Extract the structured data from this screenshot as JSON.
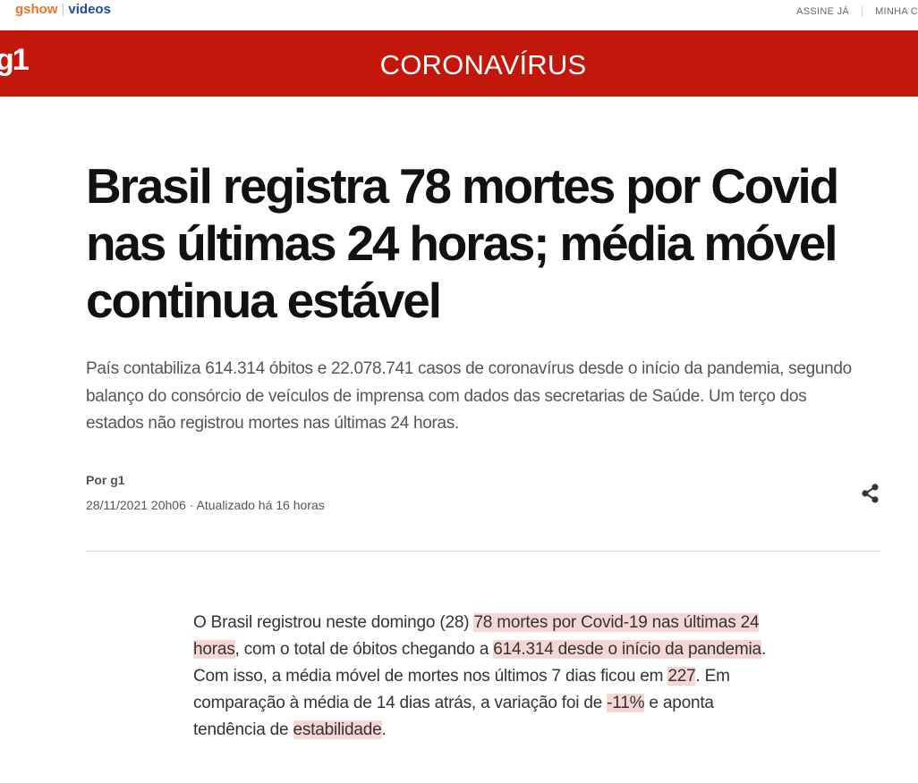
{
  "topbar": {
    "gshow": "gshow",
    "videos": "videos",
    "subscribe": "ASSINE JÁ",
    "account": "MINHA C"
  },
  "header": {
    "logo": "g1",
    "section": "CORONAVÍRUS",
    "brand_color": "#c4170c"
  },
  "article": {
    "headline": "Brasil registra 78 mortes por Covid nas últimas 24 horas; média móvel continua estável",
    "subtitle": "País contabiliza 614.314 óbitos e 22.078.741 casos de coronavírus desde o início da pandemia, segundo balanço do consórcio de veículos de imprensa com dados das secretarias de Saúde. Um terço dos estados não registrou mortes nas últimas 24 horas.",
    "byline": "Por g1",
    "dateline": "28/11/2021 20h06 · Atualizado há 16 horas",
    "share_icon": "share-icon",
    "body": {
      "p1": "O Brasil registrou neste domingo (28) ",
      "h1": "78 mortes por Covid-19 nas últimas 24 horas",
      "p2": ", com o total de óbitos chegando a ",
      "h2": "614.314 desde o início da pandemia",
      "p3": ". Com isso, a média móvel de mortes nos últimos 7 dias ficou em ",
      "h3": "227",
      "p4": ". Em comparação à média de 14 dias atrás, a variação foi de ",
      "h4": "-11%",
      "p5": " e aponta tendência de ",
      "h5": "estabilidade",
      "p6": "."
    },
    "highlight_color": "#f6d6d4"
  }
}
